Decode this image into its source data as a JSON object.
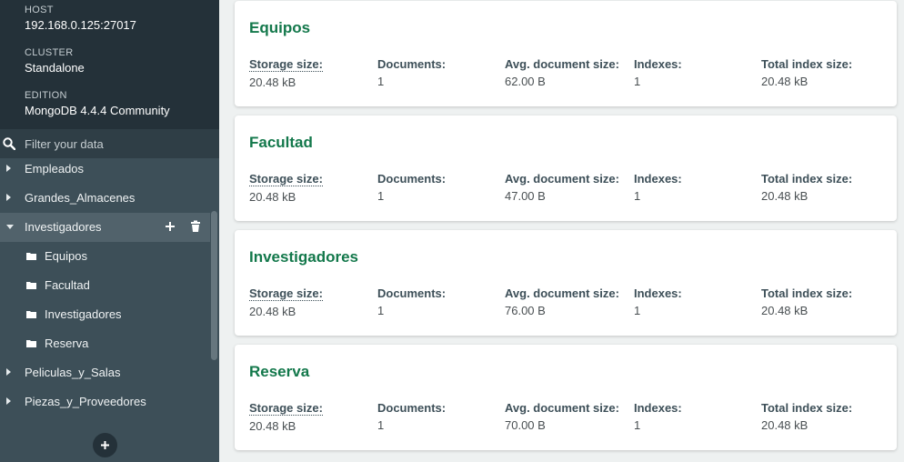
{
  "instance": {
    "host_label": "HOST",
    "host_value": "192.168.0.125:27017",
    "cluster_label": "CLUSTER",
    "cluster_value": "Standalone",
    "edition_label": "EDITION",
    "edition_value": "MongoDB 4.4.4 Community"
  },
  "filter": {
    "placeholder": "Filter your data"
  },
  "databases": [
    {
      "label": "Empleados",
      "expanded": false
    },
    {
      "label": "Grandes_Almacenes",
      "expanded": false
    },
    {
      "label": "Investigadores",
      "expanded": true
    },
    {
      "label": "Peliculas_y_Salas",
      "expanded": false
    },
    {
      "label": "Piezas_y_Proveedores",
      "expanded": false
    }
  ],
  "collections": [
    {
      "label": "Equipos"
    },
    {
      "label": "Facultad"
    },
    {
      "label": "Investigadores"
    },
    {
      "label": "Reserva"
    }
  ],
  "stat_labels": {
    "storage": "Storage size:",
    "documents": "Documents:",
    "avg": "Avg. document size:",
    "indexes": "Indexes:",
    "total_index": "Total index size:"
  },
  "cards": [
    {
      "title": "Equipos",
      "storage": "20.48 kB",
      "documents": "1",
      "avg": "62.00 B",
      "indexes": "1",
      "total_index": "20.48 kB"
    },
    {
      "title": "Facultad",
      "storage": "20.48 kB",
      "documents": "1",
      "avg": "47.00 B",
      "indexes": "1",
      "total_index": "20.48 kB"
    },
    {
      "title": "Investigadores",
      "storage": "20.48 kB",
      "documents": "1",
      "avg": "76.00 B",
      "indexes": "1",
      "total_index": "20.48 kB"
    },
    {
      "title": "Reserva",
      "storage": "20.48 kB",
      "documents": "1",
      "avg": "70.00 B",
      "indexes": "1",
      "total_index": "20.48 kB"
    }
  ],
  "colors": {
    "accent_green": "#13784b",
    "sidebar_bg": "#3d4f58",
    "sidebar_dark": "#243139"
  },
  "icons": {
    "search": "search-icon",
    "caret_right": "caret-right-icon",
    "caret_down": "caret-down-icon",
    "plus": "plus-icon",
    "trash": "trash-icon",
    "folder": "folder-icon"
  }
}
